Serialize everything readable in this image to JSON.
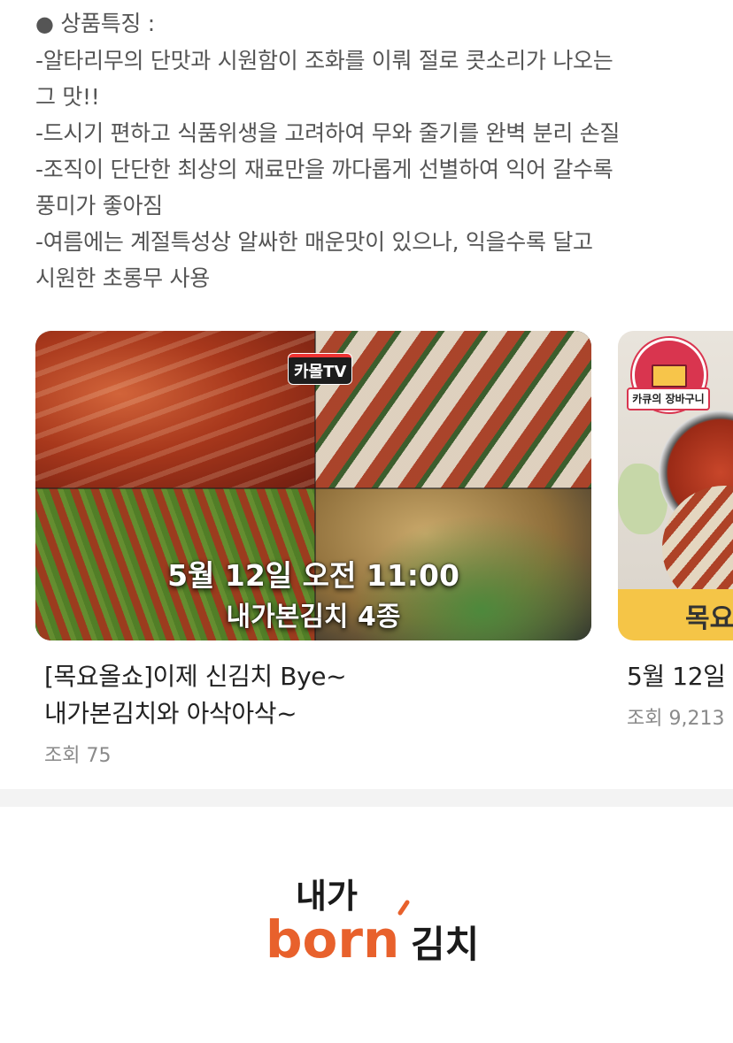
{
  "features": {
    "title": "상품특징 :",
    "lines": [
      "-알타리무의 단맛과 시원함이 조화를 이뤄 절로 콧소리가 나오는",
      "그 맛!!",
      "-드시기 편하고 식품위생을 고려하여 무와 줄기를 완벽 분리 손질",
      "-조직이 단단한 최상의 재료만을 까다롭게 선별하여 익어 갈수록",
      "풍미가 좋아짐",
      "-여름에는 계절특성상 알싸한 매운맛이 있으나, 익을수록 달고",
      "시원한 초롱무 사용"
    ]
  },
  "videos": [
    {
      "logo": "카몰TV",
      "thumb_line1": "5월 12일 오전 11:00",
      "thumb_line2": "내가본김치 4종",
      "title_line1": "[목요올쇼]이제 신김치 Bye~",
      "title_line2": "내가본김치와 아삭아삭~",
      "views": "조회 75"
    },
    {
      "badge_label": "카큐의 장바구니",
      "thumb_text": "목요",
      "title": "5월 12일",
      "views": "조회 9,213"
    }
  ],
  "brand": {
    "logo_top": "내가",
    "logo_word": "born",
    "logo_tail": "김치",
    "colors": {
      "dark": "#1a1a1a",
      "orange": "#e8612c"
    }
  }
}
